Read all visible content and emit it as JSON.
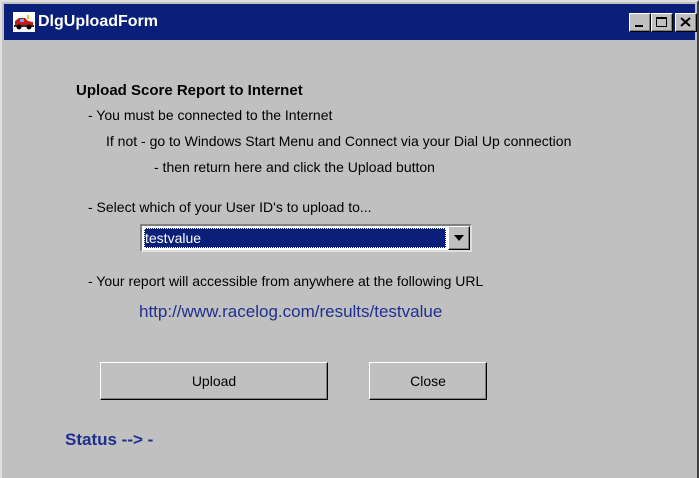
{
  "window": {
    "title": "DlgUploadForm",
    "icon": "racecar-app-icon",
    "controls": [
      "minimize-icon",
      "maximize-icon",
      "close-icon"
    ]
  },
  "form": {
    "heading": "Upload Score Report to Internet",
    "line1": "- You must be connected to the Internet",
    "line2": "If not   - go to Windows Start Menu and Connect via your Dial Up connection",
    "line3": "- then return here and click the Upload button",
    "select_prompt": "- Select which of your User ID's to upload to...",
    "user_id_selected": "testvalue",
    "url_prompt": "- Your report will accessible from anywhere at the following URL",
    "url": "http://www.racelog.com/results/testvalue",
    "upload_label": "Upload",
    "close_label": "Close",
    "status": "Status --> -"
  },
  "colors": {
    "titlebar": "#0a1f7a",
    "face": "#c0c0c0",
    "link_text": "#1f2f8f"
  }
}
